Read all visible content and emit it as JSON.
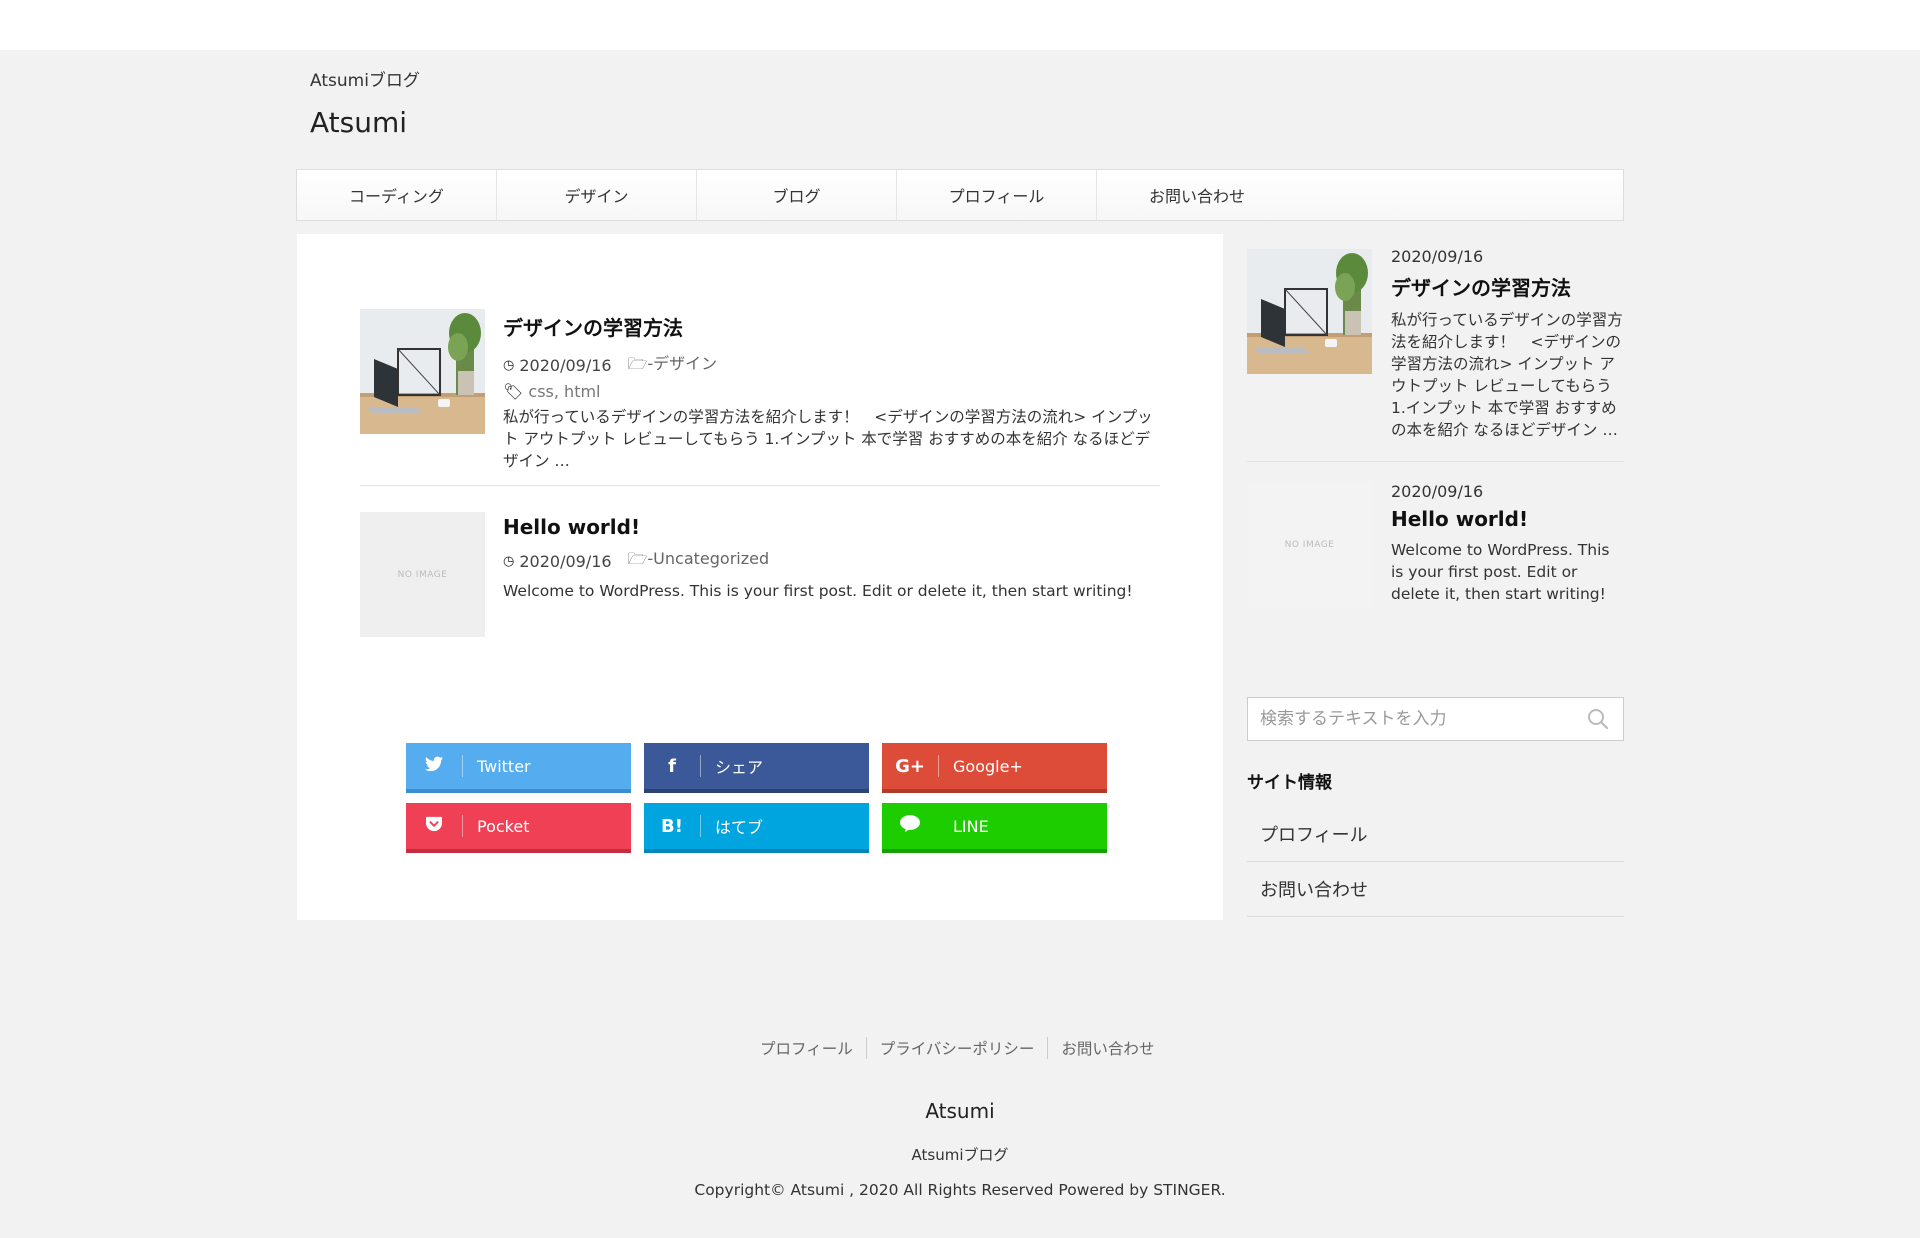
{
  "header": {
    "tagline": "Atsumiブログ",
    "title": "Atsumi"
  },
  "nav": {
    "items": [
      "コーディング",
      "デザイン",
      "ブログ",
      "プロフィール",
      "お問い合わせ"
    ]
  },
  "posts": [
    {
      "title": "デザインの学習方法",
      "date": "2020/09/16",
      "category": "-デザイン",
      "tags": [
        "css",
        "html"
      ],
      "excerpt": "私が行っているデザインの学習方法を紹介します！　<デザインの学習方法の流れ> インプット アウトプット レビューしてもらう 1.インプット 本で学習 おすすめの本を紹介 なるほどデザイン …"
    },
    {
      "title": "Hello world!",
      "date": "2020/09/16",
      "category": "-Uncategorized",
      "excerpt": "Welcome to WordPress. This is your first post. Edit or delete it, then start writing!",
      "thumb_text": "NO IMAGE"
    }
  ],
  "sns": {
    "twitter": "Twitter",
    "facebook": "シェア",
    "googleplus": "Google+",
    "pocket": "Pocket",
    "hatena": "はてブ",
    "line": "LINE",
    "icons": {
      "hatena": "B!",
      "googleplus": "G+",
      "facebook": "f"
    },
    "colors": {
      "twitter": "#55acee",
      "facebook": "#3b5998",
      "googleplus": "#dd4b39",
      "pocket": "#ef4056",
      "hatena": "#00a4de",
      "line": "#1dcd00"
    }
  },
  "sidebar": {
    "posts": [
      {
        "date": "2020/09/16",
        "title": "デザインの学習方法",
        "excerpt": "私が行っているデザインの学習方法を紹介します！　<デザインの学習方法の流れ> インプット アウトプット レビューしてもらう 1.インプット 本で学習 おすすめの本を紹介 なるほどデザイン …"
      },
      {
        "date": "2020/09/16",
        "title": "Hello world!",
        "excerpt": "Welcome to WordPress. This is your first post. Edit or delete it, then start writing!",
        "thumb_text": "NO IMAGE"
      }
    ],
    "search_placeholder": "検索するテキストを入力",
    "info_title": "サイト情報",
    "menu": [
      "プロフィール",
      "お問い合わせ"
    ]
  },
  "footer": {
    "links": [
      "プロフィール",
      "プライバシーポリシー",
      "お問い合わせ"
    ],
    "title": "Atsumi",
    "tagline": "Atsumiブログ",
    "copyright": "Copyright© Atsumi , 2020 All Rights Reserved Powered by STINGER."
  }
}
